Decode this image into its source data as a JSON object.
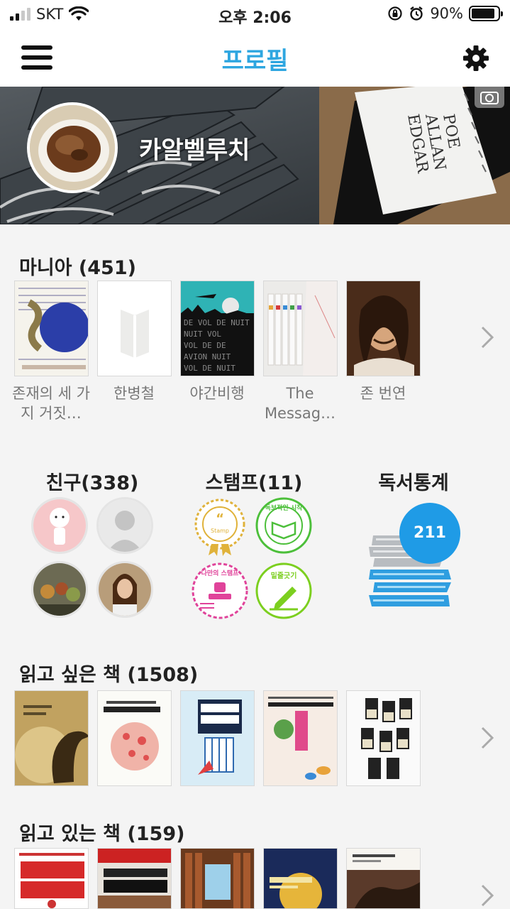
{
  "status_bar": {
    "carrier": "SKT",
    "time": "오후 2:06",
    "battery_percent": "90%",
    "battery_level": 0.9
  },
  "nav": {
    "title": "프로필",
    "menu_icon": "hamburger-icon",
    "settings_icon": "gear-icon"
  },
  "profile": {
    "username": "카알벨루치",
    "cover_icon": "camera-icon"
  },
  "mania": {
    "title": "마니아 (451)",
    "books": [
      {
        "label": "존재의 세 가지 거짓…"
      },
      {
        "label": "한병철"
      },
      {
        "label": "야간비행"
      },
      {
        "label": "The Messag…"
      },
      {
        "label": "존 번연"
      }
    ]
  },
  "friends": {
    "title": "친구(338)"
  },
  "stamps": {
    "title": "스탬프(11)",
    "items": [
      {
        "text": "Stamp"
      },
      {
        "text": "독보적인 시작"
      },
      {
        "text": "나만의 스탬프"
      },
      {
        "text": "밑줄긋기"
      }
    ]
  },
  "reading_stats": {
    "title": "독서통계",
    "count": "211"
  },
  "want_to_read": {
    "title": "읽고 싶은 책 (1508)"
  },
  "reading_now": {
    "title": "읽고 있는 책 (159)"
  },
  "colors": {
    "accent": "#2ea6e0",
    "badge": "#1f9be6",
    "stamp_gold": "#e0b23a",
    "stamp_green": "#4cbf3a",
    "stamp_pink": "#e0439a",
    "stamp_lime": "#7ccf1f"
  }
}
